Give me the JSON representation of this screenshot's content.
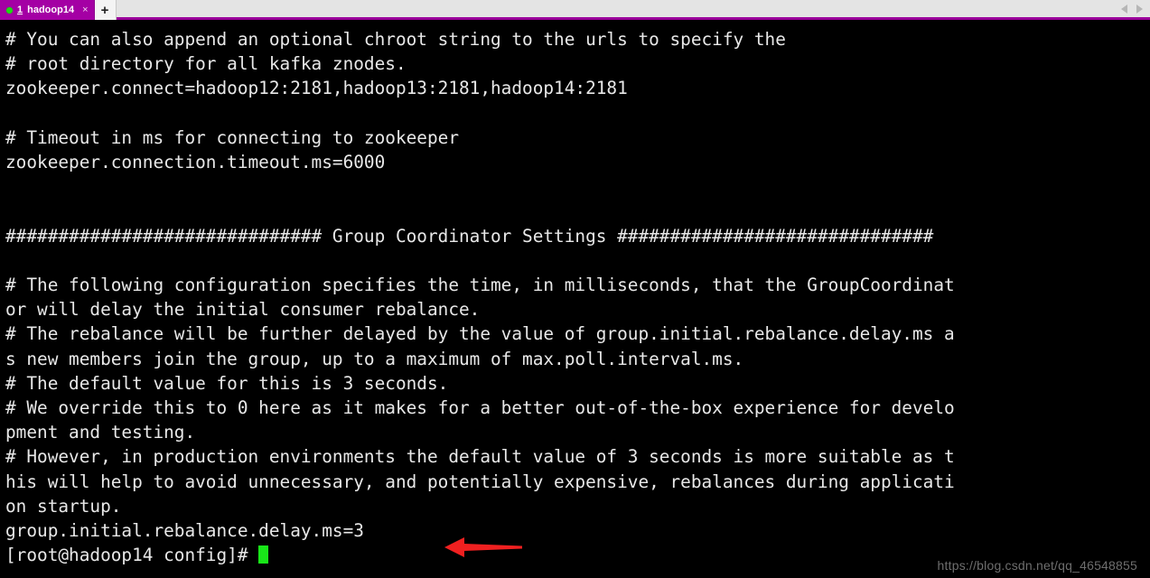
{
  "window": {
    "title": "1 hadoop14"
  },
  "tabbar": {
    "tabs": [
      {
        "index": "1",
        "title": "hadoop14",
        "close_label": "×",
        "status_color": "#1fd814",
        "background_color": "#a400a4"
      }
    ],
    "new_tab_label": "+",
    "nav_prev_label": "◀",
    "nav_next_label": "▶"
  },
  "terminal": {
    "foreground_color": "#e8e8e8",
    "background_color": "#000000",
    "cursor_color": "#19e619",
    "columns": 105,
    "content": "# You can also append an optional chroot string to the urls to specify the\n# root directory for all kafka znodes.\nzookeeper.connect=hadoop12:2181,hadoop13:2181,hadoop14:2181\n\n# Timeout in ms for connecting to zookeeper\nzookeeper.connection.timeout.ms=6000\n\n\n############################## Group Coordinator Settings ##############################\n\n# The following configuration specifies the time, in milliseconds, that the GroupCoordinat\nor will delay the initial consumer rebalance.\n# The rebalance will be further delayed by the value of group.initial.rebalance.delay.ms a\ns new members join the group, up to a maximum of max.poll.interval.ms.\n# The default value for this is 3 seconds.\n# We override this to 0 here as it makes for a better out-of-the-box experience for develo\npment and testing.\n# However, in production environments the default value of 3 seconds is more suitable as t\nhis will help to avoid unnecessary, and potentially expensive, rebalances during applicati\non startup.\ngroup.initial.rebalance.delay.ms=3",
    "prompt": "[root@hadoop14 config]# ",
    "prompt_user": "root",
    "prompt_host": "hadoop14",
    "prompt_dir": "config",
    "prompt_symbol": "#",
    "highlighted_line": "group.initial.rebalance.delay.ms=3"
  },
  "annotation": {
    "arrow_color": "#f02020",
    "arrow_direction": "left",
    "points_at": "group.initial.rebalance.delay.ms=3"
  },
  "watermark": {
    "text": "https://blog.csdn.net/qq_46548855"
  }
}
